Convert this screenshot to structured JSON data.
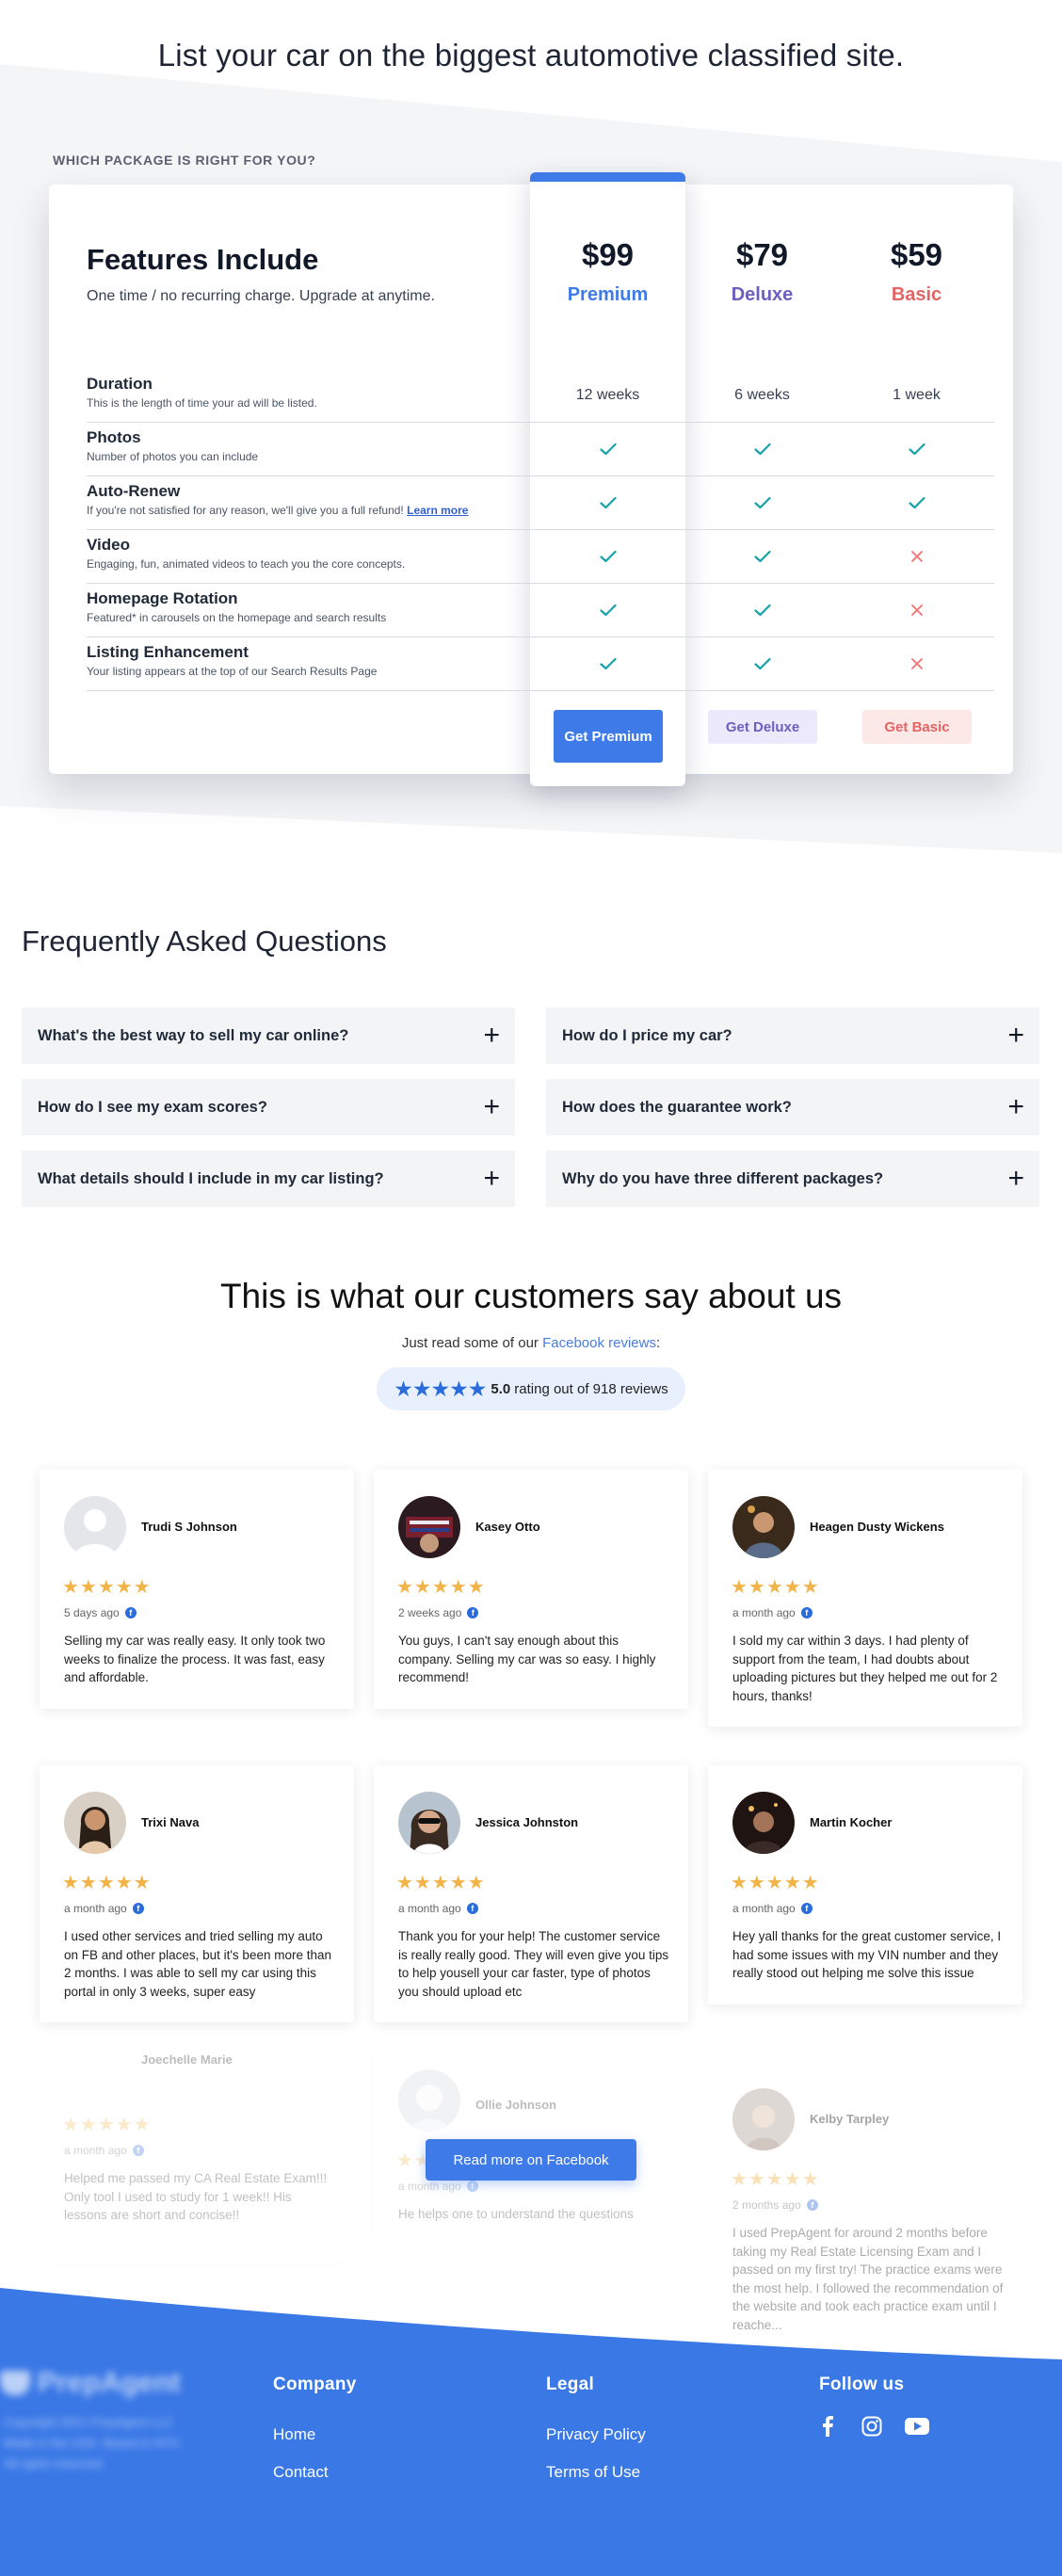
{
  "hero": {
    "title": "List your car on the biggest automotive classified site.",
    "package_question": "WHICH PACKAGE IS RIGHT FOR YOU?"
  },
  "pricing": {
    "features_title": "Features Include",
    "features_subtitle": "One time / no recurring charge. Upgrade at anytime.",
    "tiers": [
      {
        "price": "$99",
        "name": "Premium",
        "color": "#3f7be8",
        "button": "Get Premium"
      },
      {
        "price": "$79",
        "name": "Deluxe",
        "color": "#6b5fbf",
        "button": "Get Deluxe"
      },
      {
        "price": "$59",
        "name": "Basic",
        "color": "#e36464",
        "button": "Get Basic"
      }
    ],
    "features": [
      {
        "name": "Duration",
        "desc": "This is the length of time your ad will be listed.",
        "values": [
          "12 weeks",
          "6 weeks",
          "1 week"
        ]
      },
      {
        "name": "Photos",
        "desc": "Number of photos you can include",
        "values": [
          "check",
          "check",
          "check"
        ]
      },
      {
        "name": "Auto-Renew",
        "desc": "If you're not satisfied for any reason, we'll give you a full refund!",
        "link": "Learn more",
        "values": [
          "check",
          "check",
          "check"
        ]
      },
      {
        "name": "Video",
        "desc": "Engaging, fun, animated videos to teach you the core concepts.",
        "values": [
          "check",
          "check",
          "cross"
        ]
      },
      {
        "name": "Homepage Rotation",
        "desc": "Featured* in carousels on the homepage and search results",
        "values": [
          "check",
          "check",
          "cross"
        ]
      },
      {
        "name": "Listing Enhancement",
        "desc": "Your listing appears at the top of our Search Results Page",
        "values": [
          "check",
          "check",
          "cross"
        ]
      }
    ]
  },
  "faq": {
    "title": "Frequently Asked Questions",
    "items": [
      "What's the best way to sell my car online?",
      "How do I price my car?",
      "How do I see my exam scores?",
      "How does the guarantee work?",
      "What details should I include in my car listing?",
      "Why do you have three different packages?"
    ]
  },
  "testimonials": {
    "title": "This is what our customers say about us",
    "sub_prefix": "Just read some of our ",
    "sub_link": "Facebook reviews",
    "sub_suffix": ":",
    "rating_value": "5.0",
    "rating_text": "rating out of 918 reviews",
    "stars": "★★★★★",
    "fb_mark": "f",
    "read_more": "Read more on Facebook",
    "reviews": [
      {
        "name": "Trudi S Johnson",
        "date": "5 days ago",
        "text": "Selling my car was really easy. It only took two weeks to finalize the process. It was fast, easy and affordable."
      },
      {
        "name": "Kasey Otto",
        "date": "2 weeks ago",
        "text": "You guys, I can't say enough about this company. Selling my car was so easy. I highly recommend!"
      },
      {
        "name": "Heagen Dusty Wickens",
        "date": "a month ago",
        "text": "I sold my car within 3 days. I had plenty of support from the team, I had doubts about uploading pictures but they helped me out for 2 hours, thanks!"
      },
      {
        "name": "Trixi Nava",
        "date": "a month ago",
        "text": "I used other services and tried selling my auto on FB and other places, but it's been more than 2 months. I was able to sell my car using this portal in only 3 weeks, super easy"
      },
      {
        "name": "Jessica Johnston",
        "date": "a month ago",
        "text": "Thank you for your help! The customer service is really really good. They will even give you tips to help yousell your car faster, type of photos you should upload etc"
      },
      {
        "name": "Martin Kocher",
        "date": "a month ago",
        "text": "Hey yall thanks for the great customer service, I had some issues with my VIN number and they really stood out helping me solve this issue"
      },
      {
        "name": "Joechelle Marie",
        "date": "a month ago",
        "text": "Helped me passed my CA Real Estate Exam!!! Only tool I used to study for 1 week!! His lessons are short and concise!!"
      },
      {
        "name": "Ollie Johnson",
        "date": "a month ago",
        "text": "He helps one to understand the questions"
      },
      {
        "name": "Kelby Tarpley",
        "date": "2 months ago",
        "text": "I used PrepAgent for around 2 months before taking my Real Estate Licensing Exam and I passed on my first try! The practice exams were the most help. I followed the recommendation of the website and took each practice exam until I reache..."
      }
    ]
  },
  "footer": {
    "brand": "PrepAgent",
    "brand_lines": [
      "Copyright 2021 PrepAgent LLC",
      "Made in the USA. Based in NYC.",
      "All rights reserved."
    ],
    "company_title": "Company",
    "company_links": [
      "Home",
      "Contact"
    ],
    "legal_title": "Legal",
    "legal_links": [
      "Privacy Policy",
      "Terms of Use"
    ],
    "follow_title": "Follow us",
    "social_icons": [
      "facebook-icon",
      "instagram-icon",
      "youtube-icon"
    ],
    "color": "#3a78e6"
  }
}
